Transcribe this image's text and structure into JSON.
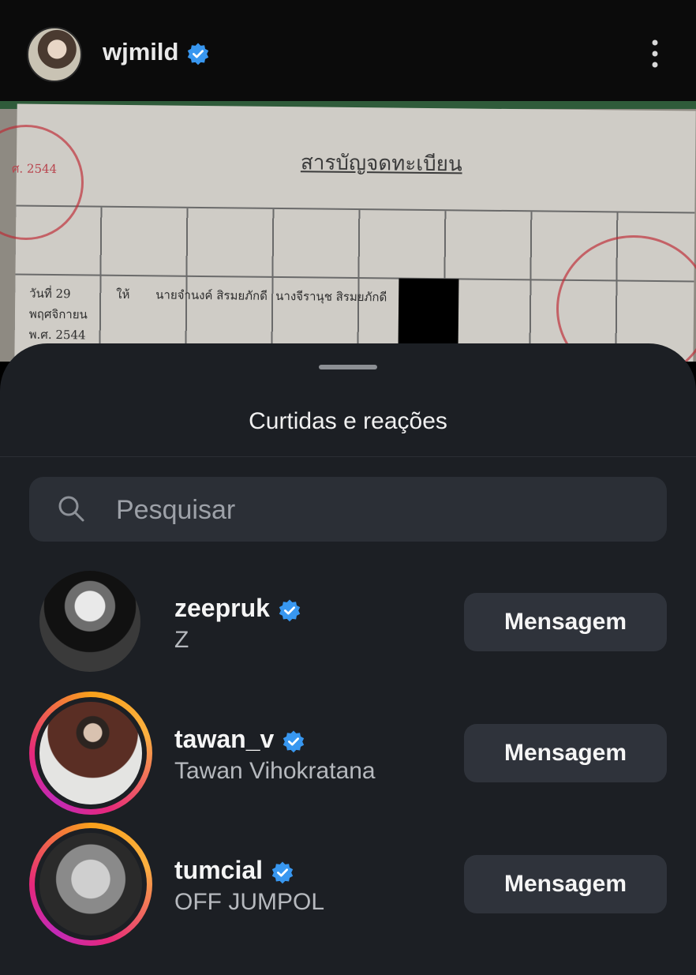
{
  "header": {
    "username": "wjmild",
    "verified": true
  },
  "photo": {
    "document_title": "สารบัญจดทะเบียน",
    "cells": {
      "date_line1": "วันที่ 29",
      "date_line2": "พฤศจิกายน",
      "date_line3": "พ.ศ. 2544",
      "type": "ให้",
      "giver": "นายจำนงค์ สิรมยภักดี",
      "receiver": "นางจีรานุช สิรมยภักดี",
      "stamp_text": "ศ. 2544"
    }
  },
  "panel": {
    "title": "Curtidas e reações",
    "search_placeholder": "Pesquisar"
  },
  "users": [
    {
      "username": "zeepruk",
      "fullname": "Z",
      "verified": true,
      "button": "Mensagem",
      "story_ring": false
    },
    {
      "username": "tawan_v",
      "fullname": "Tawan Vihokratana",
      "verified": true,
      "button": "Mensagem",
      "story_ring": true
    },
    {
      "username": "tumcial",
      "fullname": "OFF JUMPOL",
      "verified": true,
      "button": "Mensagem",
      "story_ring": true
    }
  ],
  "colors": {
    "verified_badge": "#3897f0",
    "panel_bg": "#1c1f24",
    "button_bg": "#2f333b"
  },
  "icons": [
    "verified-badge-icon",
    "more-vertical-icon",
    "search-icon"
  ]
}
